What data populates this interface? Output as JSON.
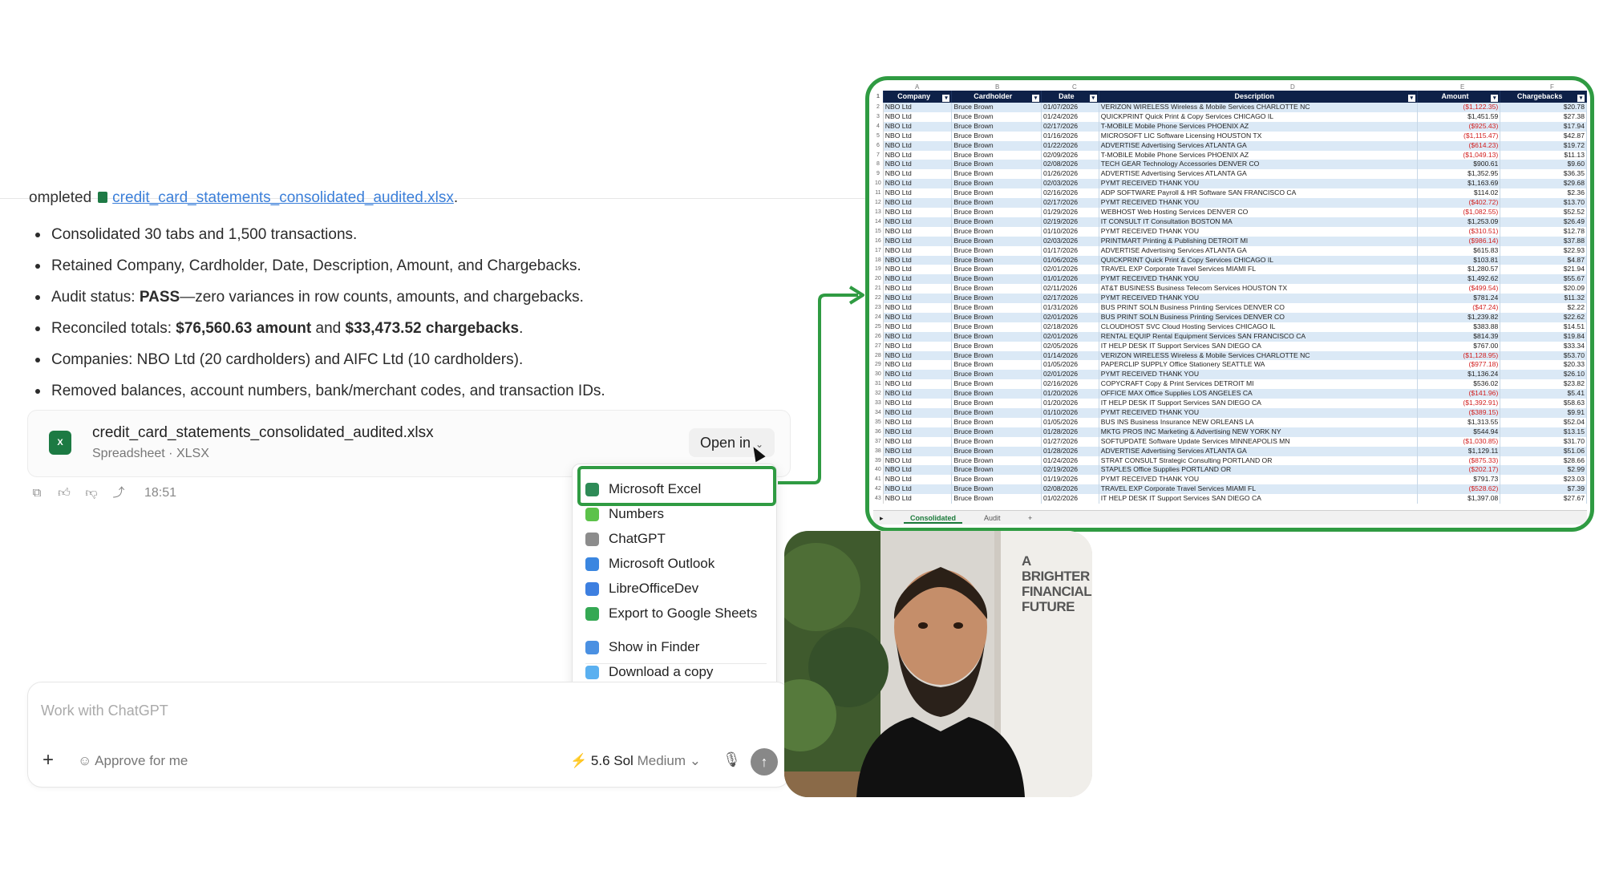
{
  "chat": {
    "completed_prefix": "ompleted",
    "completed_file": "credit_card_statements_consolidated_audited.xlsx",
    "completed_suffix": ".",
    "bullets": [
      {
        "parts": [
          {
            "t": "Consolidated 30 tabs and 1,500 transactions.",
            "b": false
          }
        ]
      },
      {
        "parts": [
          {
            "t": "Retained Company, Cardholder, Date, Description, Amount, and Chargebacks.",
            "b": false
          }
        ]
      },
      {
        "parts": [
          {
            "t": "Audit status: ",
            "b": false
          },
          {
            "t": "PASS",
            "b": true
          },
          {
            "t": "—zero variances in row counts, amounts, and chargebacks.",
            "b": false
          }
        ]
      },
      {
        "parts": [
          {
            "t": "Reconciled totals: ",
            "b": false
          },
          {
            "t": "$76,560.63 amount",
            "b": true
          },
          {
            "t": " and ",
            "b": false
          },
          {
            "t": "$33,473.52 chargebacks",
            "b": true
          },
          {
            "t": ".",
            "b": false
          }
        ]
      },
      {
        "parts": [
          {
            "t": "Companies: NBO Ltd (20 cardholders) and AIFC Ltd (10 cardholders).",
            "b": false
          }
        ]
      },
      {
        "parts": [
          {
            "t": "Removed balances, account numbers, bank/merchant codes, and transaction IDs.",
            "b": false
          }
        ]
      }
    ],
    "file_card": {
      "name": "credit_card_statements_consolidated_audited.xlsx",
      "sub": "Spreadsheet · XLSX",
      "icon_label": "X",
      "open_in": "Open in"
    },
    "time": "18:51"
  },
  "menu": {
    "items": [
      {
        "label": "Microsoft Excel",
        "icon": "excel-icon",
        "color": "#2e8b57"
      },
      {
        "label": "Numbers",
        "icon": "numbers-icon",
        "color": "#5cc24a"
      },
      {
        "label": "ChatGPT",
        "icon": "chatgpt-icon",
        "color": "#8c8c8c"
      },
      {
        "label": "Microsoft Outlook",
        "icon": "outlook-icon",
        "color": "#3a86e0"
      },
      {
        "label": "LibreOfficeDev",
        "icon": "libreoffice-icon",
        "color": "#3d7fe0"
      },
      {
        "label": "Export to Google Sheets",
        "icon": "google-sheets-icon",
        "color": "#34a853"
      },
      {
        "label": "Show in Finder",
        "icon": "finder-icon",
        "color": "#4a90e2"
      },
      {
        "label": "Download a copy",
        "icon": "folder-icon",
        "color": "#5ab0f0"
      }
    ]
  },
  "input": {
    "placeholder": "Work with ChatGPT",
    "approve": "Approve for me",
    "model": "5.6 Sol",
    "level": "Medium"
  },
  "sheet": {
    "column_letters": [
      "A",
      "B",
      "C",
      "D",
      "E",
      "F"
    ],
    "headers": [
      "Company",
      "Cardholder",
      "Date",
      "Description",
      "Amount",
      "Chargebacks"
    ],
    "rows": [
      [
        "NBO Ltd",
        "Bruce Brown",
        "01/07/2026",
        "VERIZON WIRELESS Wireless & Mobile Services CHARLOTTE NC",
        "($1,122.35)",
        "$20.78"
      ],
      [
        "NBO Ltd",
        "Bruce Brown",
        "01/24/2026",
        "QUICKPRINT Quick Print & Copy Services CHICAGO IL",
        "$1,451.59",
        "$27.38"
      ],
      [
        "NBO Ltd",
        "Bruce Brown",
        "02/17/2026",
        "T-MOBILE Mobile Phone Services PHOENIX AZ",
        "($925.43)",
        "$17.94"
      ],
      [
        "NBO Ltd",
        "Bruce Brown",
        "01/16/2026",
        "MICROSOFT LIC Software Licensing HOUSTON TX",
        "($1,115.47)",
        "$42.87"
      ],
      [
        "NBO Ltd",
        "Bruce Brown",
        "01/22/2026",
        "ADVERTISE Advertising Services ATLANTA GA",
        "($614.23)",
        "$19.72"
      ],
      [
        "NBO Ltd",
        "Bruce Brown",
        "02/09/2026",
        "T-MOBILE Mobile Phone Services PHOENIX AZ",
        "($1,049.13)",
        "$11.13"
      ],
      [
        "NBO Ltd",
        "Bruce Brown",
        "02/08/2026",
        "TECH GEAR Technology Accessories DENVER CO",
        "$900.61",
        "$9.60"
      ],
      [
        "NBO Ltd",
        "Bruce Brown",
        "01/26/2026",
        "ADVERTISE Advertising Services ATLANTA GA",
        "$1,352.95",
        "$36.35"
      ],
      [
        "NBO Ltd",
        "Bruce Brown",
        "02/03/2026",
        "PYMT RECEIVED THANK YOU",
        "$1,163.69",
        "$29.68"
      ],
      [
        "NBO Ltd",
        "Bruce Brown",
        "02/16/2026",
        "ADP SOFTWARE Payroll & HR Software SAN FRANCISCO CA",
        "$114.02",
        "$2.36"
      ],
      [
        "NBO Ltd",
        "Bruce Brown",
        "02/17/2026",
        "PYMT RECEIVED THANK YOU",
        "($402.72)",
        "$13.70"
      ],
      [
        "NBO Ltd",
        "Bruce Brown",
        "01/29/2026",
        "WEBHOST Web Hosting Services DENVER CO",
        "($1,082.55)",
        "$52.52"
      ],
      [
        "NBO Ltd",
        "Bruce Brown",
        "02/19/2026",
        "IT CONSULT IT Consultation BOSTON MA",
        "$1,253.09",
        "$26.49"
      ],
      [
        "NBO Ltd",
        "Bruce Brown",
        "01/10/2026",
        "PYMT RECEIVED THANK YOU",
        "($310.51)",
        "$12.78"
      ],
      [
        "NBO Ltd",
        "Bruce Brown",
        "02/03/2026",
        "PRINTMART Printing & Publishing DETROIT MI",
        "($986.14)",
        "$37.88"
      ],
      [
        "NBO Ltd",
        "Bruce Brown",
        "01/17/2026",
        "ADVERTISE Advertising Services ATLANTA GA",
        "$615.83",
        "$22.93"
      ],
      [
        "NBO Ltd",
        "Bruce Brown",
        "01/06/2026",
        "QUICKPRINT Quick Print & Copy Services CHICAGO IL",
        "$103.81",
        "$4.87"
      ],
      [
        "NBO Ltd",
        "Bruce Brown",
        "02/01/2026",
        "TRAVEL EXP Corporate Travel Services MIAMI FL",
        "$1,280.57",
        "$21.94"
      ],
      [
        "NBO Ltd",
        "Bruce Brown",
        "01/01/2026",
        "PYMT RECEIVED THANK YOU",
        "$1,492.62",
        "$55.67"
      ],
      [
        "NBO Ltd",
        "Bruce Brown",
        "02/11/2026",
        "AT&T BUSINESS Business Telecom Services HOUSTON TX",
        "($499.54)",
        "$20.09"
      ],
      [
        "NBO Ltd",
        "Bruce Brown",
        "02/17/2026",
        "PYMT RECEIVED THANK YOU",
        "$781.24",
        "$11.32"
      ],
      [
        "NBO Ltd",
        "Bruce Brown",
        "01/31/2026",
        "BUS PRINT SOLN Business Printing Services DENVER CO",
        "($47.24)",
        "$2.22"
      ],
      [
        "NBO Ltd",
        "Bruce Brown",
        "02/01/2026",
        "BUS PRINT SOLN Business Printing Services DENVER CO",
        "$1,239.82",
        "$22.62"
      ],
      [
        "NBO Ltd",
        "Bruce Brown",
        "02/18/2026",
        "CLOUDHOST SVC Cloud Hosting Services CHICAGO IL",
        "$383.88",
        "$14.51"
      ],
      [
        "NBO Ltd",
        "Bruce Brown",
        "02/01/2026",
        "RENTAL EQUIP Rental Equipment Services SAN FRANCISCO CA",
        "$814.39",
        "$19.84"
      ],
      [
        "NBO Ltd",
        "Bruce Brown",
        "02/05/2026",
        "IT HELP DESK IT Support Services SAN DIEGO CA",
        "$767.00",
        "$33.34"
      ],
      [
        "NBO Ltd",
        "Bruce Brown",
        "01/14/2026",
        "VERIZON WIRELESS Wireless & Mobile Services CHARLOTTE NC",
        "($1,128.95)",
        "$53.70"
      ],
      [
        "NBO Ltd",
        "Bruce Brown",
        "01/05/2026",
        "PAPERCLIP SUPPLY Office Stationery SEATTLE WA",
        "($977.18)",
        "$20.33"
      ],
      [
        "NBO Ltd",
        "Bruce Brown",
        "02/01/2026",
        "PYMT RECEIVED THANK YOU",
        "$1,136.24",
        "$26.10"
      ],
      [
        "NBO Ltd",
        "Bruce Brown",
        "02/16/2026",
        "COPYCRAFT Copy & Print Services DETROIT MI",
        "$536.02",
        "$23.82"
      ],
      [
        "NBO Ltd",
        "Bruce Brown",
        "01/20/2026",
        "OFFICE MAX Office Supplies LOS ANGELES CA",
        "($141.96)",
        "$5.41"
      ],
      [
        "NBO Ltd",
        "Bruce Brown",
        "01/20/2026",
        "IT HELP DESK IT Support Services SAN DIEGO CA",
        "($1,392.91)",
        "$58.63"
      ],
      [
        "NBO Ltd",
        "Bruce Brown",
        "01/10/2026",
        "PYMT RECEIVED THANK YOU",
        "($389.15)",
        "$9.91"
      ],
      [
        "NBO Ltd",
        "Bruce Brown",
        "01/05/2026",
        "BUS INS Business Insurance NEW ORLEANS LA",
        "$1,313.55",
        "$52.04"
      ],
      [
        "NBO Ltd",
        "Bruce Brown",
        "01/28/2026",
        "MKTG PROS INC Marketing & Advertising NEW YORK NY",
        "$544.94",
        "$13.15"
      ],
      [
        "NBO Ltd",
        "Bruce Brown",
        "01/27/2026",
        "SOFTUPDATE Software Update Services MINNEAPOLIS MN",
        "($1,030.85)",
        "$31.70"
      ],
      [
        "NBO Ltd",
        "Bruce Brown",
        "01/28/2026",
        "ADVERTISE Advertising Services ATLANTA GA",
        "$1,129.11",
        "$51.06"
      ],
      [
        "NBO Ltd",
        "Bruce Brown",
        "01/24/2026",
        "STRAT CONSULT Strategic Consulting PORTLAND OR",
        "($875.33)",
        "$28.66"
      ],
      [
        "NBO Ltd",
        "Bruce Brown",
        "02/19/2026",
        "STAPLES Office Supplies PORTLAND OR",
        "($202.17)",
        "$2.99"
      ],
      [
        "NBO Ltd",
        "Bruce Brown",
        "01/19/2026",
        "PYMT RECEIVED THANK YOU",
        "$791.73",
        "$23.03"
      ],
      [
        "NBO Ltd",
        "Bruce Brown",
        "02/08/2026",
        "TRAVEL EXP Corporate Travel Services MIAMI FL",
        "($528.62)",
        "$7.39"
      ],
      [
        "NBO Ltd",
        "Bruce Brown",
        "01/02/2026",
        "IT HELP DESK IT Support Services SAN DIEGO CA",
        "$1,397.08",
        "$27.67"
      ]
    ],
    "tabs": {
      "active": "Consolidated",
      "other": "Audit",
      "add": "+"
    }
  },
  "overlay": {
    "poster_text": [
      "A",
      "BRIGHTER",
      "FINANCIAL",
      "FUTURE"
    ]
  },
  "colors": {
    "highlight": "#2f9b42",
    "header_bg": "#0e2148",
    "row_band": "#dbe9f6",
    "negative": "#d21f1f",
    "link": "#3b7fd9"
  }
}
